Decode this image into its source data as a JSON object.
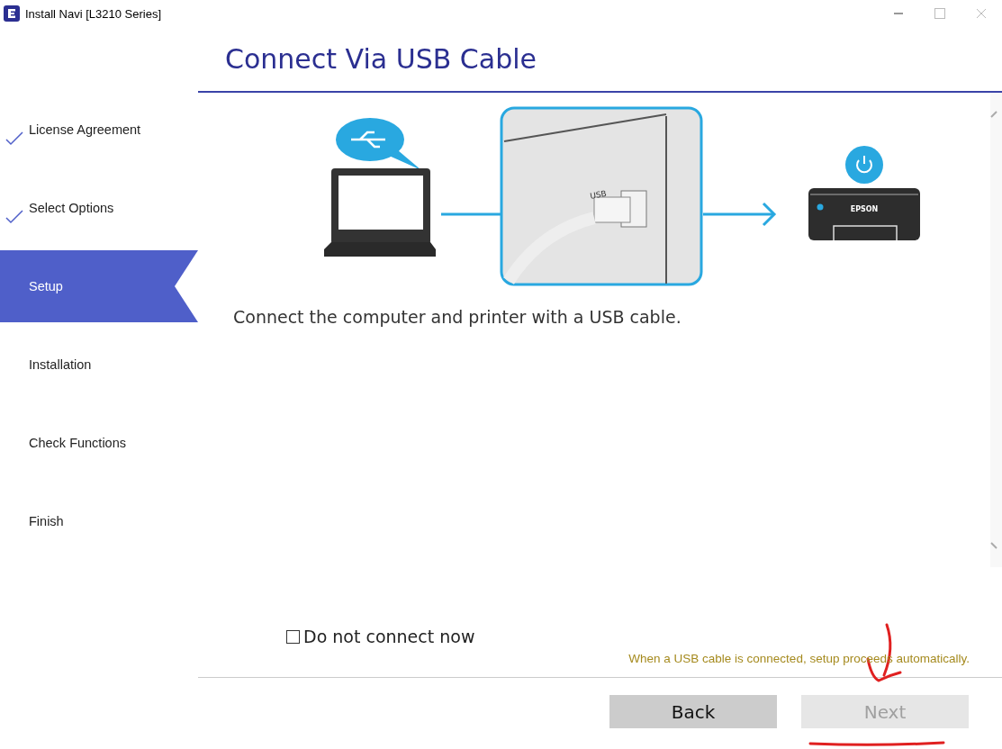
{
  "window": {
    "title": "Install Navi [L3210 Series]"
  },
  "steps": [
    {
      "label": "License Agreement",
      "checked": true,
      "selected": false
    },
    {
      "label": "Select Options",
      "checked": true,
      "selected": false
    },
    {
      "label": "Setup",
      "checked": false,
      "selected": true
    },
    {
      "label": "Installation",
      "checked": false,
      "selected": false
    },
    {
      "label": "Check Functions",
      "checked": false,
      "selected": false
    },
    {
      "label": "Finish",
      "checked": false,
      "selected": false
    }
  ],
  "heading": "Connect Via USB Cable",
  "illustration": {
    "port_label": "USB",
    "printer_label": "EPSON"
  },
  "instruction": "Connect the computer and printer with a USB cable.",
  "skip_option": {
    "label": "Do not connect now",
    "checked": false
  },
  "note": "When a USB cable is connected, setup proceeds automatically.",
  "buttons": [
    {
      "label": "Back",
      "disabled": false
    },
    {
      "label": "Next",
      "disabled": true
    }
  ]
}
